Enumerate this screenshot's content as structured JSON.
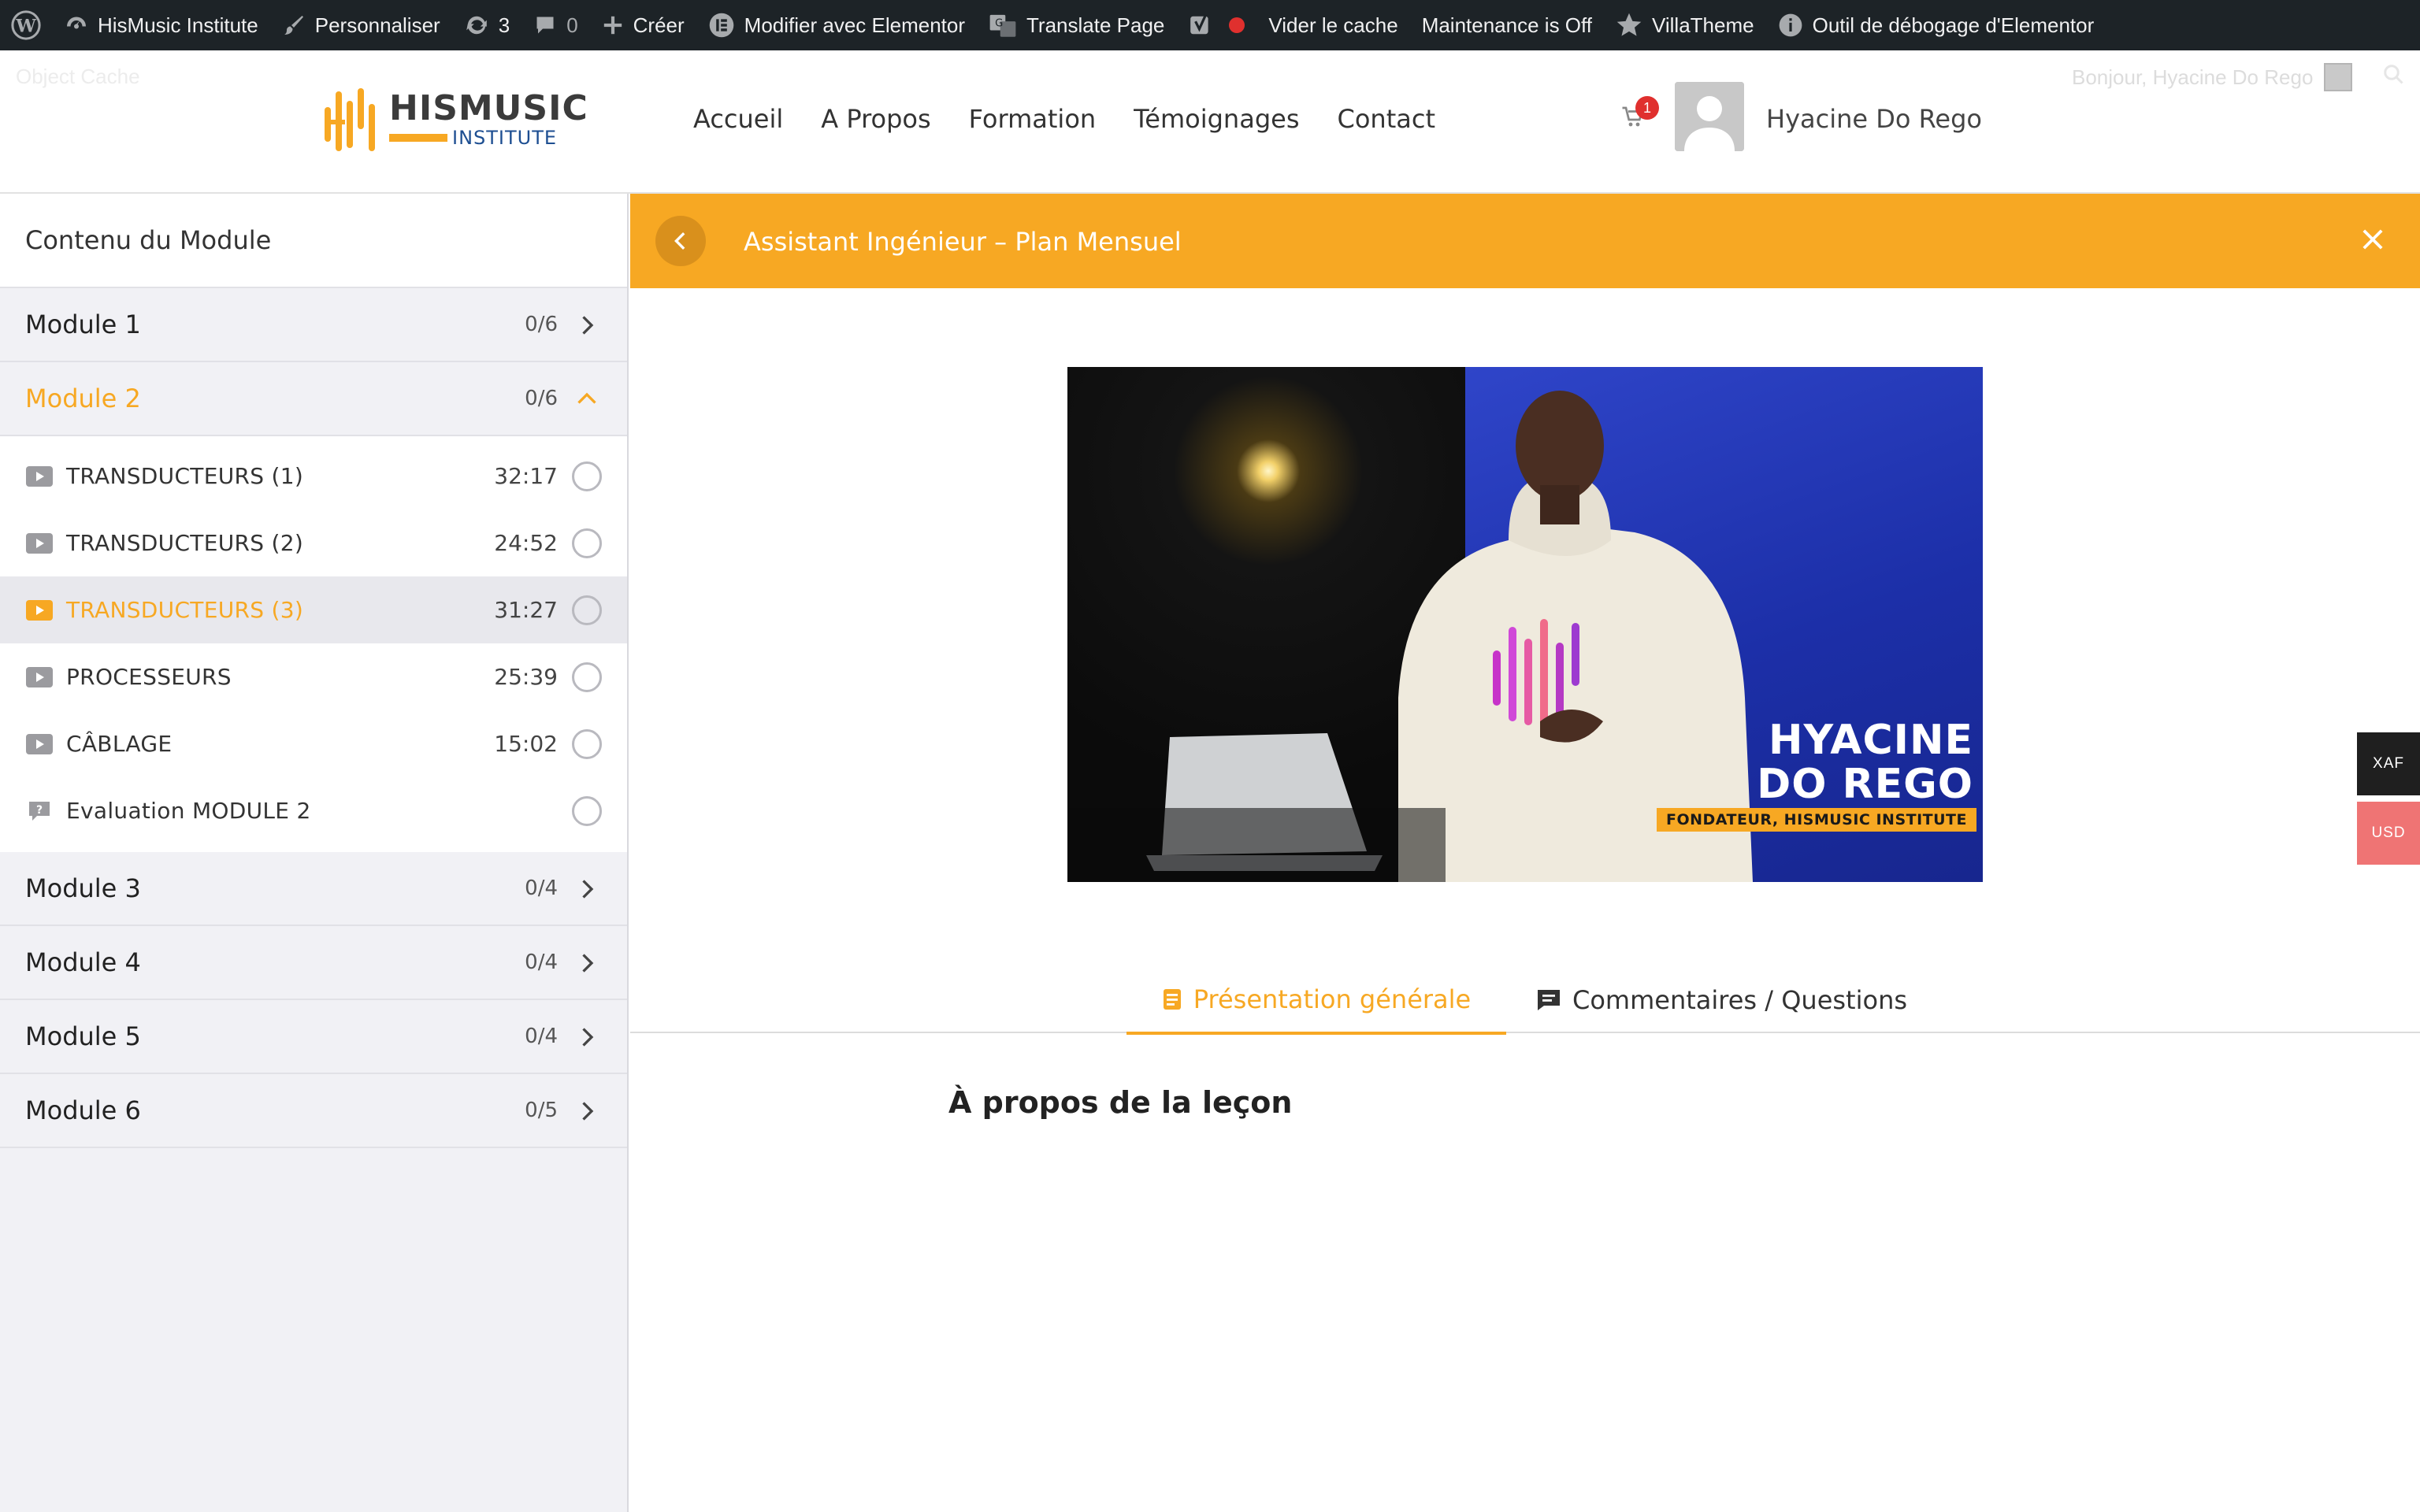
{
  "admin_bar": {
    "site_name": "HisMusic Institute",
    "customize": "Personnaliser",
    "updates_count": "3",
    "comments_count": "0",
    "new": "Créer",
    "elementor_edit": "Modifier avec Elementor",
    "translate": "Translate Page",
    "clear_cache": "Vider le cache",
    "maintenance": "Maintenance is Off",
    "villatheme": "VillaTheme",
    "elementor_debug": "Outil de débogage d'Elementor"
  },
  "header": {
    "object_cache": "Object Cache",
    "greeting": "Bonjour, Hyacine Do Rego",
    "logo_line1": "HISMUSIC",
    "logo_line2": "INSTITUTE",
    "nav": [
      "Accueil",
      "A Propos",
      "Formation",
      "Témoignages",
      "Contact"
    ],
    "cart_count": "1",
    "user_name": "Hyacine Do Rego"
  },
  "sidebar": {
    "title": "Contenu du Module",
    "modules": [
      {
        "name": "Module 1",
        "progress": "0/6"
      },
      {
        "name": "Module 2",
        "progress": "0/6"
      },
      {
        "name": "Module 3",
        "progress": "0/4"
      },
      {
        "name": "Module 4",
        "progress": "0/4"
      },
      {
        "name": "Module 5",
        "progress": "0/4"
      },
      {
        "name": "Module 6",
        "progress": "0/5"
      }
    ],
    "lessons": [
      {
        "name": "TRANSDUCTEURS (1)",
        "duration": "32:17",
        "type": "video"
      },
      {
        "name": "TRANSDUCTEURS (2)",
        "duration": "24:52",
        "type": "video"
      },
      {
        "name": "TRANSDUCTEURS (3)",
        "duration": "31:27",
        "type": "video"
      },
      {
        "name": "PROCESSEURS",
        "duration": "25:39",
        "type": "video"
      },
      {
        "name": "CÂBLAGE",
        "duration": "15:02",
        "type": "video"
      },
      {
        "name": "Evaluation MODULE 2",
        "duration": "",
        "type": "quiz"
      }
    ]
  },
  "lesson": {
    "course_title": "Assistant Ingénieur – Plan Mensuel",
    "video_overlay_name_line1": "HYACINE",
    "video_overlay_name_line2": "DO REGO",
    "video_overlay_role": "FONDATEUR, HISMUSIC INSTITUTE",
    "tabs": [
      "Présentation générale",
      "Commentaires / Questions"
    ],
    "about_heading": "À propos de la leçon"
  },
  "currency": {
    "options": [
      "XAF",
      "USD"
    ]
  },
  "colors": {
    "accent": "#f7a823",
    "admin_bar": "#1d2327",
    "brand_blue": "#1d4e91"
  }
}
